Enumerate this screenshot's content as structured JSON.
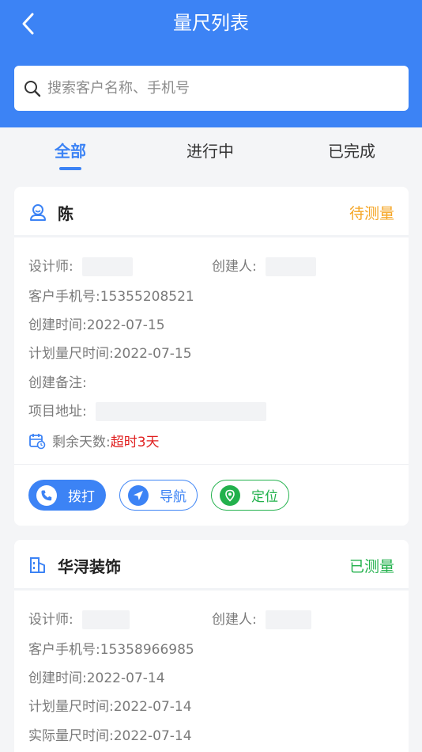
{
  "header": {
    "title": "量尺列表",
    "search_placeholder": "搜索客户名称、手机号"
  },
  "tabs": [
    {
      "label": "全部"
    },
    {
      "label": "进行中"
    },
    {
      "label": "已完成"
    }
  ],
  "cards": [
    {
      "name": "陈",
      "status": "待测量",
      "designer_label": "设计师:",
      "creator_label": "创建人:",
      "phone_label": "客户手机号:",
      "phone": "15355208521",
      "created_label": "创建时间:",
      "created": "2022-07-15",
      "planned_label": "计划量尺时间:",
      "planned": "2022-07-15",
      "note_label": "创建备注:",
      "address_label": "项目地址:",
      "remaining_label": "剩余天数:",
      "remaining": "超时3天",
      "actions": {
        "call": "拨打",
        "navigate": "导航",
        "locate": "定位"
      }
    },
    {
      "name": "华浔装饰",
      "status": "已测量",
      "designer_label": "设计师:",
      "creator_label": "创建人:",
      "phone_label": "客户手机号:",
      "phone": "15358966985",
      "created_label": "创建时间:",
      "created": "2022-07-14",
      "planned_label": "计划量尺时间:",
      "planned": "2022-07-14",
      "actual_label": "实际量尺时间:",
      "actual": "2022-07-14"
    }
  ],
  "colors": {
    "primary": "#3c83f5",
    "pending": "#f5a524",
    "done": "#22b14c",
    "overdue": "#e02020"
  }
}
